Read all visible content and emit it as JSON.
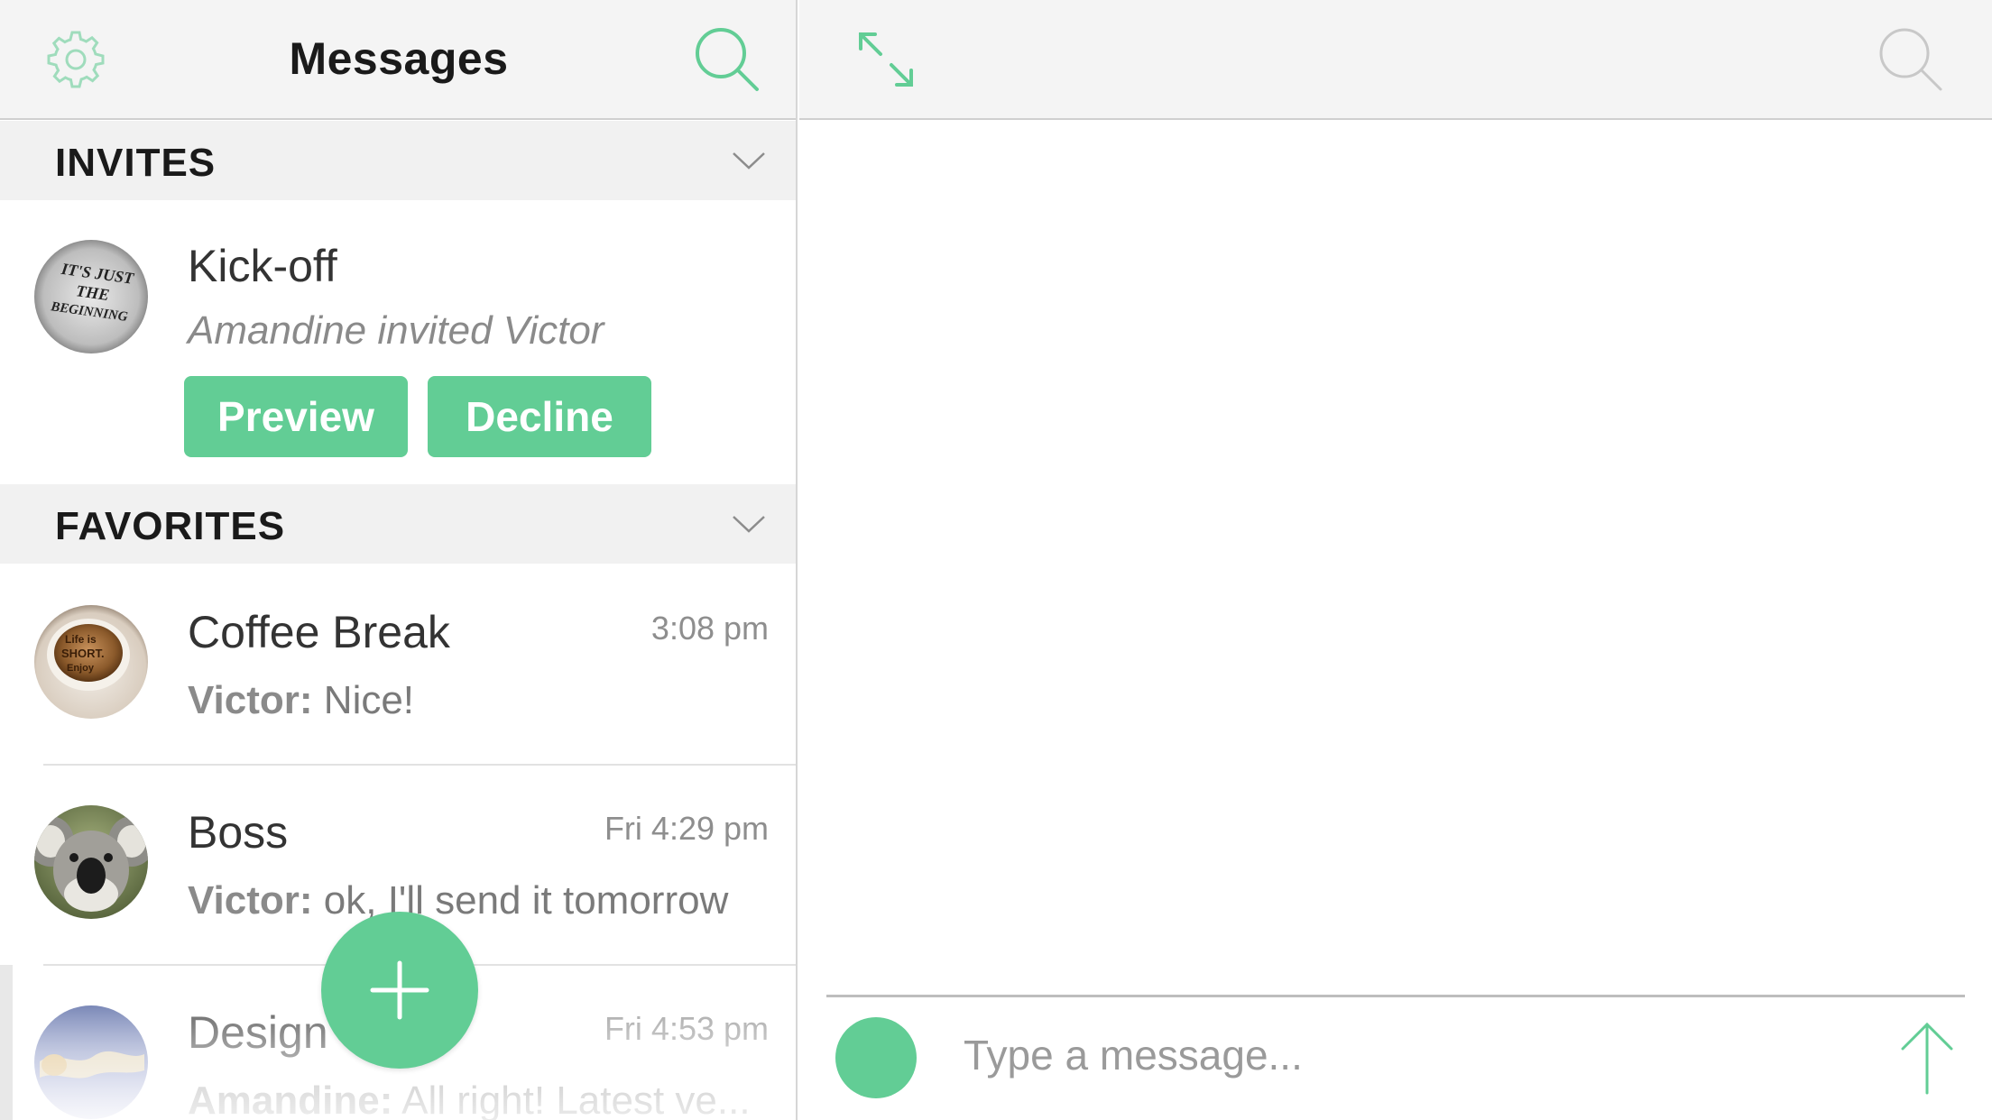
{
  "header": {
    "title": "Messages",
    "settings_icon": "gear-icon",
    "search_icon": "search-icon"
  },
  "sections": {
    "invites": {
      "title": "INVITES",
      "chevron_icon": "chevron-down-icon",
      "items": [
        {
          "name": "Kick-off",
          "subtitle": "Amandine invited Victor",
          "avatar_text": [
            "IT'S JUST",
            "THE",
            "BEGINNING"
          ],
          "preview_label": "Preview",
          "decline_label": "Decline"
        }
      ]
    },
    "favorites": {
      "title": "FAVORITES",
      "chevron_icon": "chevron-down-icon",
      "items": [
        {
          "name": "Coffee Break",
          "time": "3:08 pm",
          "sender": "Victor:",
          "message": " Nice!",
          "avatar_text": [
            "Life is",
            "SHORT.",
            "Enjoy"
          ]
        },
        {
          "name": "Boss",
          "time": "Fri 4:29 pm",
          "sender": "Victor:",
          "message": " ok, I'll send it tomorrow"
        },
        {
          "name": "Design",
          "time": "Fri 4:53 pm",
          "sender": "Amandine:",
          "message": " All right! Latest ve..."
        }
      ]
    }
  },
  "fab": {
    "icon": "plus-icon"
  },
  "right_pane": {
    "expand_icon": "expand-icon",
    "search_icon": "search-icon"
  },
  "composer": {
    "placeholder": "Type a message...",
    "send_icon": "send-arrow-icon"
  },
  "colors": {
    "accent": "#62cd95",
    "header_bg": "#f4f4f4",
    "section_bg": "#f1f1f1",
    "muted_text": "#8e8e8e"
  }
}
